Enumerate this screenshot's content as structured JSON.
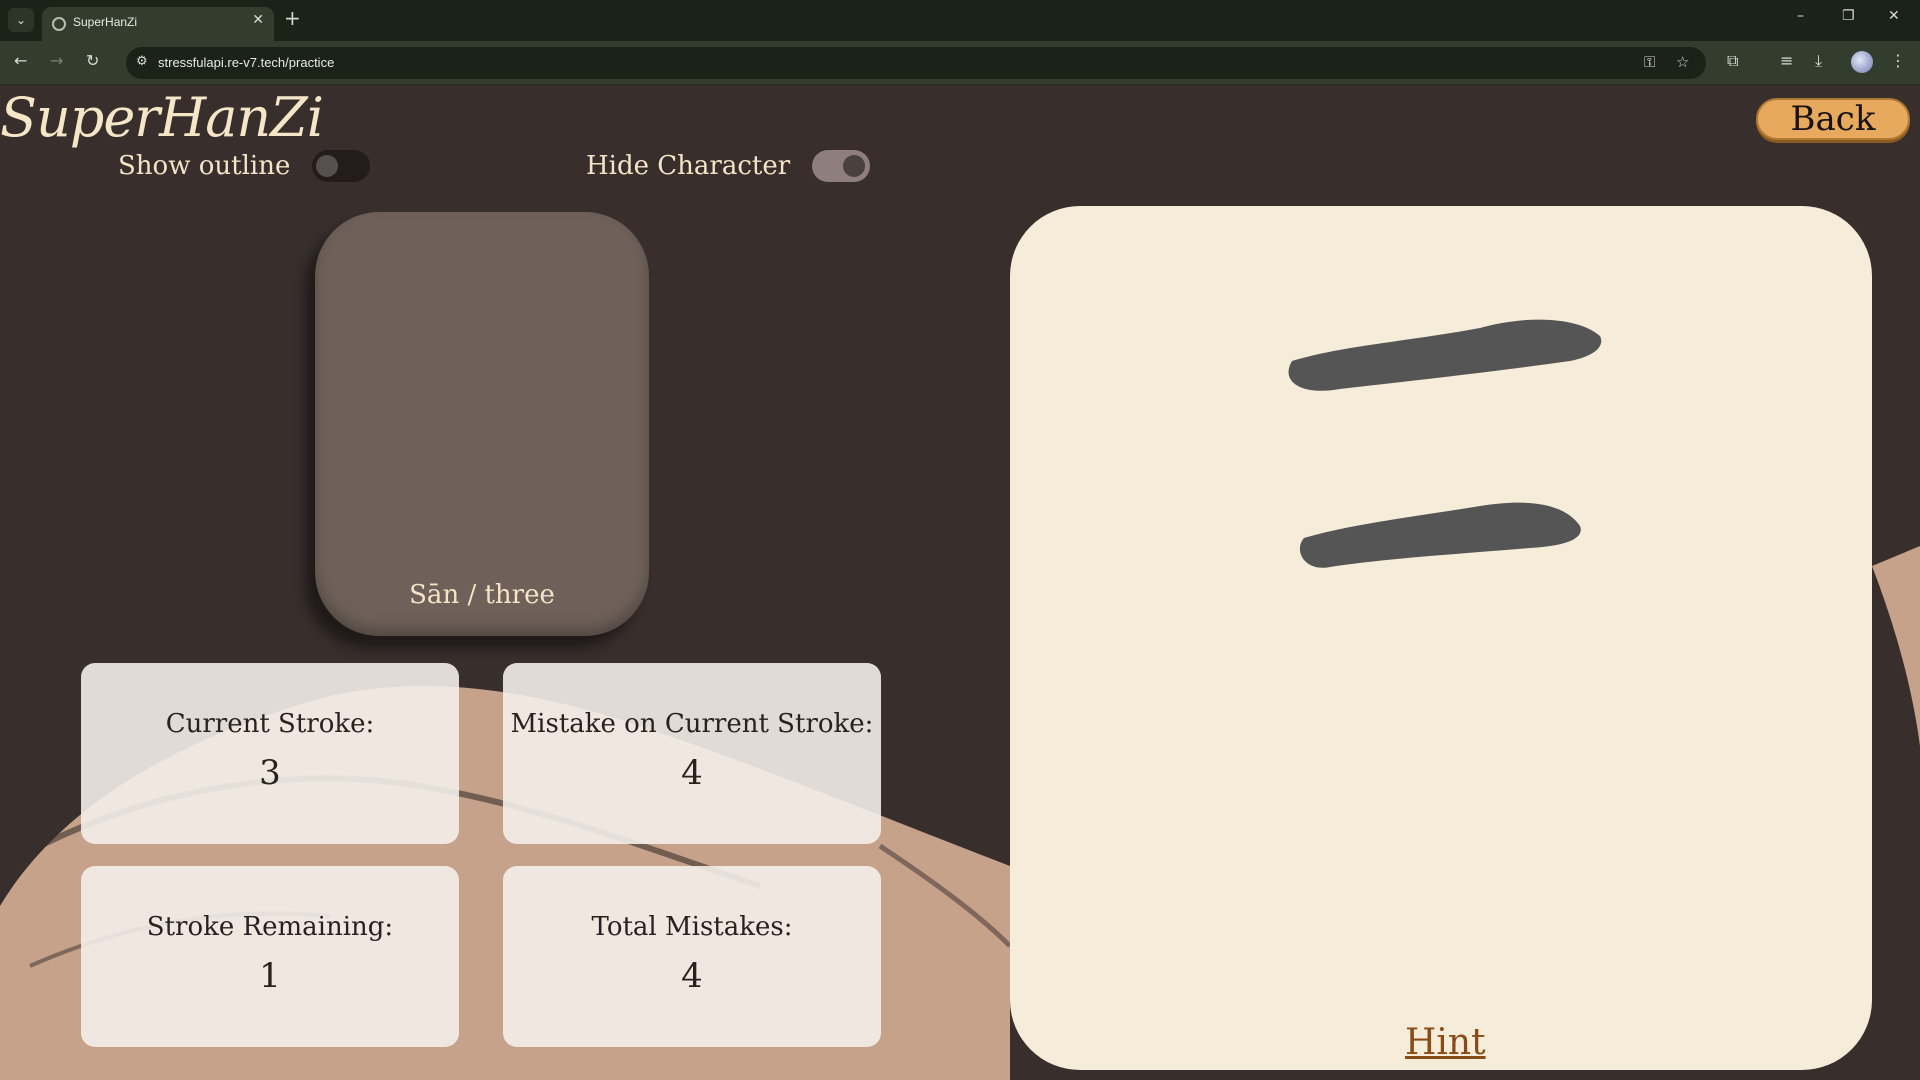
{
  "browser": {
    "tab_title": "SuperHanZi",
    "url": "stressfulapi.re-v7.tech/practice"
  },
  "app": {
    "logo_text": "SuperHanZi",
    "show_outline_label": "Show outline",
    "show_outline_on": false,
    "hide_character_label": "Hide Character",
    "hide_character_on": true,
    "back_label": "Back",
    "character_caption": "Sān / three",
    "hint_label": "Hint"
  },
  "stats": {
    "current_stroke_label": "Current Stroke:",
    "current_stroke_value": "3",
    "mistake_current_label": "Mistake on Current Stroke:",
    "mistake_current_value": "4",
    "stroke_remaining_label": "Stroke Remaining:",
    "stroke_remaining_value": "1",
    "total_mistakes_label": "Total Mistakes:",
    "total_mistakes_value": "4"
  },
  "colors": {
    "background": "#382e2c",
    "accent": "#e6a95d",
    "canvas": "#f5ecda",
    "stroke_ink": "#555555"
  },
  "icons": [
    "tab-search-icon",
    "globe-icon",
    "close-icon",
    "plus-icon",
    "minimize-icon",
    "restore-icon",
    "window-close-icon",
    "back-arrow-icon",
    "forward-arrow-icon",
    "reload-icon",
    "site-settings-icon",
    "key-icon",
    "star-icon",
    "extensions-icon",
    "media-icon",
    "download-icon",
    "menu-icon"
  ]
}
